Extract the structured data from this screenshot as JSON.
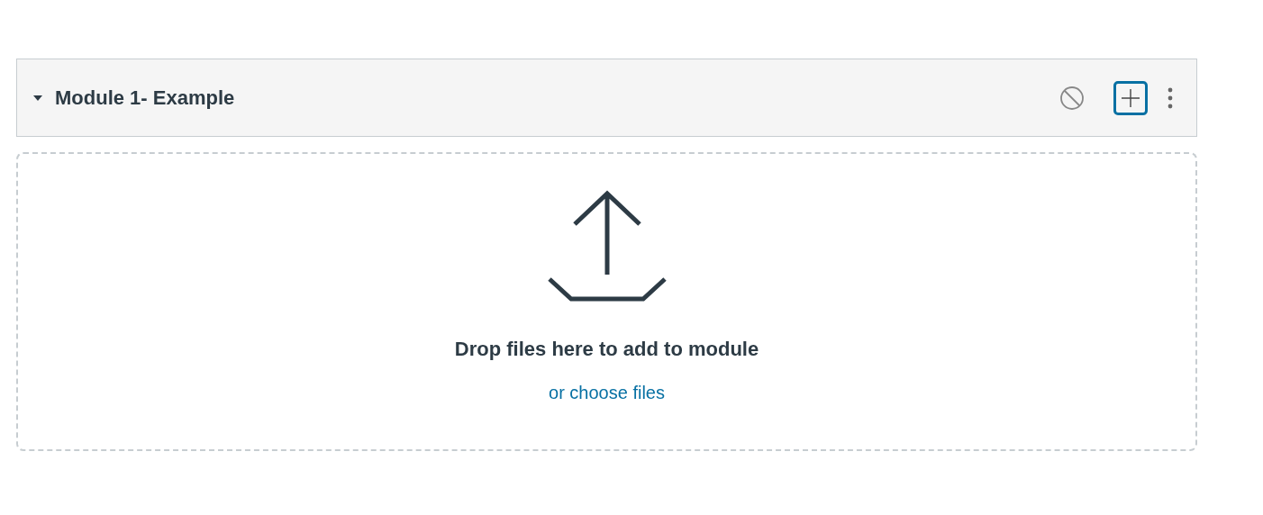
{
  "module": {
    "title": "Module 1- Example",
    "expanded": true
  },
  "dropzone": {
    "message": "Drop files here to add to module",
    "link": "or choose files"
  }
}
